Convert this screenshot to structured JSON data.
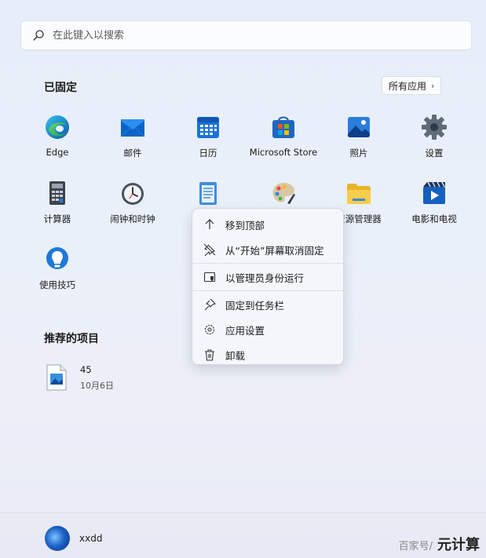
{
  "search": {
    "placeholder": "在此键入以搜索"
  },
  "pinned": {
    "title": "已固定",
    "all_apps_label": "所有应用",
    "apps": [
      {
        "label": "Edge",
        "icon": "edge-icon"
      },
      {
        "label": "邮件",
        "icon": "mail-icon"
      },
      {
        "label": "日历",
        "icon": "calendar-icon"
      },
      {
        "label": "Microsoft Store",
        "icon": "store-icon"
      },
      {
        "label": "照片",
        "icon": "photos-icon"
      },
      {
        "label": "设置",
        "icon": "settings-gear-icon"
      },
      {
        "label": "计算器",
        "icon": "calculator-icon"
      },
      {
        "label": "闹钟和时钟",
        "icon": "clock-icon"
      },
      {
        "label": "",
        "icon": "notepad-icon"
      },
      {
        "label": "",
        "icon": "paint-icon"
      },
      {
        "label": "资源管理器",
        "icon": "folder-icon"
      },
      {
        "label": "电影和电视",
        "icon": "movies-icon"
      },
      {
        "label": "使用技巧",
        "icon": "tips-icon"
      }
    ]
  },
  "recommended": {
    "title": "推荐的项目",
    "items": [
      {
        "name": "45",
        "date": "10月6日",
        "icon": "image-file-icon"
      }
    ]
  },
  "context_menu": {
    "items": [
      {
        "label": "移到顶部",
        "icon": "arrow-up-icon"
      },
      {
        "label": "从“开始”屏幕取消固定",
        "icon": "unpin-icon"
      },
      {
        "label": "以管理员身份运行",
        "icon": "shield-admin-icon"
      },
      {
        "label": "固定到任务栏",
        "icon": "pin-icon"
      },
      {
        "label": "应用设置",
        "icon": "gear-icon"
      },
      {
        "label": "卸载",
        "icon": "trash-icon"
      }
    ]
  },
  "user": {
    "name": "xxdd"
  },
  "watermark": {
    "text": "百家号/",
    "brand": "元计算"
  },
  "colors": {
    "accent": "#0067c0",
    "background": "#e9eef9",
    "menu_bg": "#f4f6fb"
  }
}
